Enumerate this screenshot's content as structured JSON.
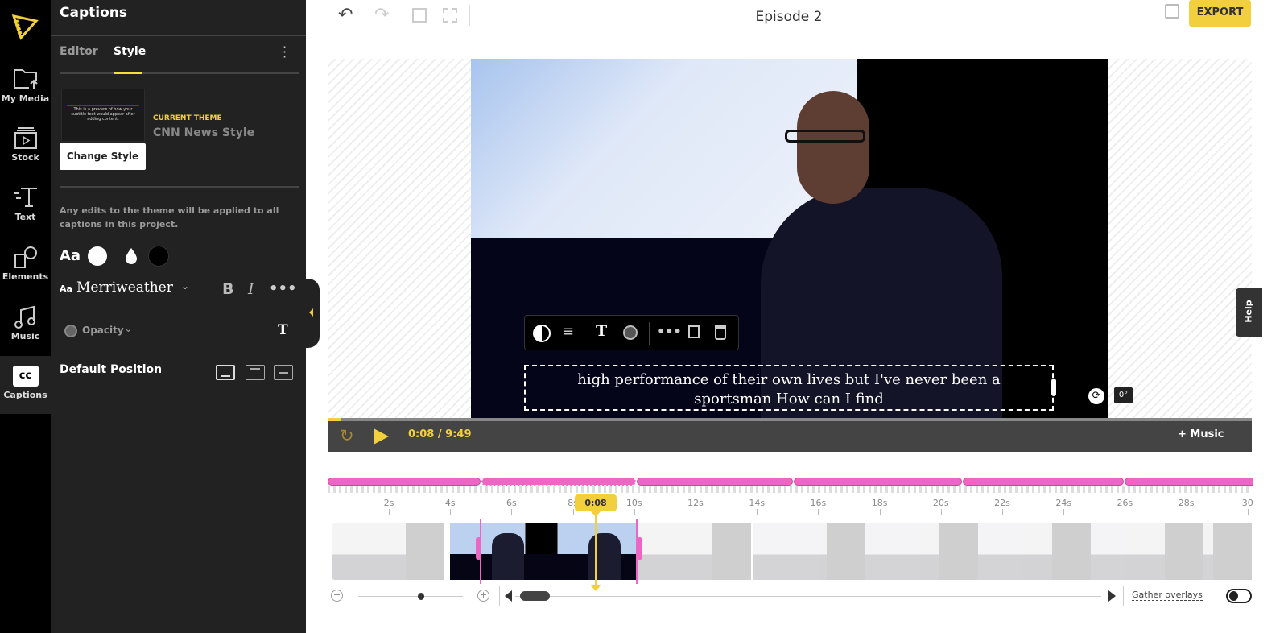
{
  "rail": {
    "items": [
      {
        "label": "My Media",
        "icon": "folder-upload-icon"
      },
      {
        "label": "Stock",
        "icon": "stock-video-icon"
      },
      {
        "label": "Text",
        "icon": "text-icon"
      },
      {
        "label": "Elements",
        "icon": "shapes-icon"
      },
      {
        "label": "Music",
        "icon": "music-icon"
      },
      {
        "label": "Captions",
        "icon": "cc-icon"
      }
    ]
  },
  "panel": {
    "title": "Captions",
    "tabs": [
      {
        "label": "Editor"
      },
      {
        "label": "Style"
      }
    ],
    "preview_text": "This is a preview of how your subtitle text would appear after adding content.",
    "current_theme_label": "CURRENT THEME",
    "current_theme": "CNN News Style",
    "change_style": "Change Style",
    "notice": "Any edits to the theme will be applied to all captions in this project.",
    "aa": "Aa",
    "font_prefix": "Aa",
    "font": "Merriweather",
    "bold": "B",
    "italic": "I",
    "opacity": "Opacity",
    "default_position": "Default Position",
    "text_color": "#ffffff",
    "bg_color": "#000000"
  },
  "header": {
    "title": "Episode 2",
    "export": "EXPORT"
  },
  "video": {
    "caption_line1": "high performance of their own lives but I've never been a",
    "caption_line2": "sportsman How can I find",
    "rotation": "0°"
  },
  "player": {
    "current": "0:08",
    "separator": "/",
    "duration": "9:49",
    "music": "+ Music",
    "progress": 0.014
  },
  "help": "Help",
  "timeline": {
    "playhead": "0:08",
    "ticks": [
      "2s",
      "4s",
      "6s",
      "8s",
      "10s",
      "12s",
      "14s",
      "16s",
      "18s",
      "20s",
      "22s",
      "24s",
      "26s",
      "28s",
      "30"
    ],
    "gather_overlays": "Gather overlays"
  },
  "colors": {
    "accent": "#f2cf3c",
    "caption_pink": "#ee66c4"
  }
}
